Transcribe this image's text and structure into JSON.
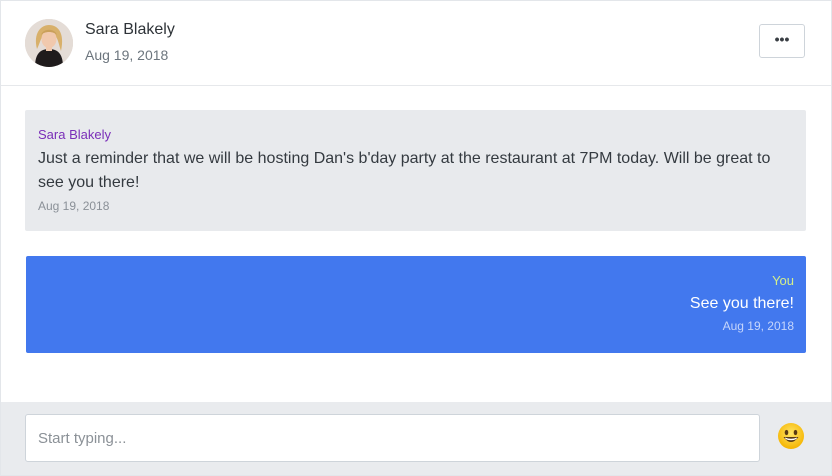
{
  "header": {
    "contact_name": "Sara Blakely",
    "contact_date": "Aug 19, 2018",
    "more_label": "•••"
  },
  "messages": [
    {
      "direction": "incoming",
      "sender": "Sara Blakely",
      "text": "Just a reminder that we will be hosting Dan's b'day party at the restaurant at 7PM today. Will be great to see you there!",
      "time": "Aug 19, 2018"
    },
    {
      "direction": "outgoing",
      "sender": "You",
      "text": "See you there!",
      "time": "Aug 19, 2018"
    }
  ],
  "composer": {
    "placeholder": "Start typing...",
    "value": "",
    "emoji_icon": "smiley-emoji-icon"
  },
  "colors": {
    "incoming_bg": "#e8eaed",
    "incoming_sender": "#7a2eb8",
    "outgoing_bg": "#4278ee",
    "outgoing_sender": "#d4ef8a",
    "composer_bg": "#e9ebee"
  }
}
